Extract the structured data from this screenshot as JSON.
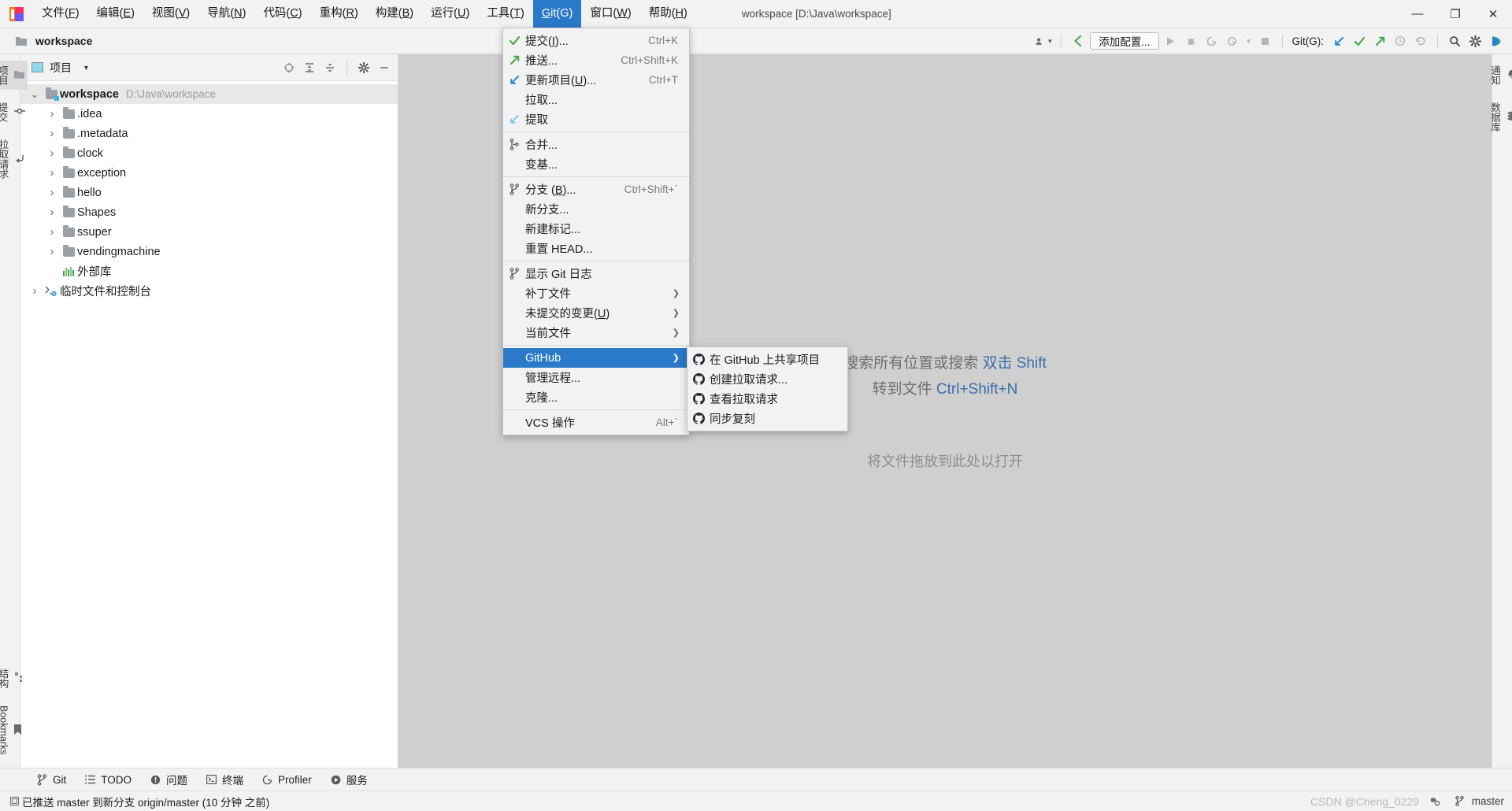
{
  "window": {
    "title": "workspace [D:\\Java\\workspace]",
    "controls": {
      "minimize": "—",
      "maximize": "❐",
      "close": "✕"
    }
  },
  "menubar": {
    "items": [
      {
        "label": "文件(F)",
        "mnemonic": "F",
        "active": false
      },
      {
        "label": "编辑(E)",
        "mnemonic": "E",
        "active": false
      },
      {
        "label": "视图(V)",
        "mnemonic": "V",
        "active": false
      },
      {
        "label": "导航(N)",
        "mnemonic": "N",
        "active": false
      },
      {
        "label": "代码(C)",
        "mnemonic": "C",
        "active": false
      },
      {
        "label": "重构(R)",
        "mnemonic": "R",
        "active": false
      },
      {
        "label": "构建(B)",
        "mnemonic": "B",
        "active": false
      },
      {
        "label": "运行(U)",
        "mnemonic": "U",
        "active": false
      },
      {
        "label": "工具(T)",
        "mnemonic": "T",
        "active": false
      },
      {
        "label": "Git(G)",
        "mnemonic": "G",
        "active": true
      },
      {
        "label": "窗口(W)",
        "mnemonic": "W",
        "active": false
      },
      {
        "label": "帮助(H)",
        "mnemonic": "H",
        "active": false
      }
    ]
  },
  "toolbar": {
    "project_name": "workspace",
    "add_config_label": "添加配置...",
    "git_label": "Git(G):",
    "icons": {
      "project_widget": "folder-icon",
      "vcs_user": "user-icon",
      "back": "back-arrow-icon",
      "run": "run-icon",
      "debug": "debug-icon",
      "run_coverage": "coverage-icon",
      "profile": "profile-icon",
      "stop": "stop-icon",
      "update": "update-project-icon",
      "commit": "commit-icon",
      "push": "push-icon",
      "history": "history-icon",
      "rollback": "rollback-icon",
      "search": "search-icon",
      "settings": "gear-icon",
      "ide_assistant": "ai-assistant-icon"
    }
  },
  "left_rail": {
    "top": [
      {
        "label": "项目",
        "icon": "project-icon",
        "selected": true
      },
      {
        "label": "提交",
        "icon": "commit-icon",
        "selected": false
      },
      {
        "label": "拉取请求",
        "icon": "pull-request-icon",
        "selected": false
      }
    ],
    "bottom": [
      {
        "label": "结构",
        "icon": "structure-icon",
        "selected": false
      },
      {
        "label": "Bookmarks",
        "icon": "bookmark-icon",
        "selected": false
      }
    ]
  },
  "right_rail": {
    "items": [
      {
        "label": "通知",
        "icon": "bell-icon",
        "badge": true
      },
      {
        "label": "数据库",
        "icon": "database-icon",
        "badge": false
      }
    ]
  },
  "project_panel": {
    "title": "项目",
    "tool_icons": [
      "locate-icon",
      "expand-all-icon",
      "collapse-all-icon",
      "gear-icon",
      "hide-icon"
    ],
    "tree": [
      {
        "label": "workspace",
        "path": "D:\\Java\\workspace",
        "arrow": "down",
        "icon": "module-folder",
        "depth": 0,
        "bold": true,
        "selected": true
      },
      {
        "label": ".idea",
        "path": "",
        "arrow": "right",
        "icon": "folder",
        "depth": 1,
        "bold": false,
        "selected": false
      },
      {
        "label": ".metadata",
        "path": "",
        "arrow": "right",
        "icon": "folder",
        "depth": 1,
        "bold": false,
        "selected": false
      },
      {
        "label": "clock",
        "path": "",
        "arrow": "right",
        "icon": "folder",
        "depth": 1,
        "bold": false,
        "selected": false
      },
      {
        "label": "exception",
        "path": "",
        "arrow": "right",
        "icon": "folder",
        "depth": 1,
        "bold": false,
        "selected": false
      },
      {
        "label": "hello",
        "path": "",
        "arrow": "right",
        "icon": "folder",
        "depth": 1,
        "bold": false,
        "selected": false
      },
      {
        "label": "Shapes",
        "path": "",
        "arrow": "right",
        "icon": "folder",
        "depth": 1,
        "bold": false,
        "selected": false
      },
      {
        "label": "ssuper",
        "path": "",
        "arrow": "right",
        "icon": "folder",
        "depth": 1,
        "bold": false,
        "selected": false
      },
      {
        "label": "vendingmachine",
        "path": "",
        "arrow": "right",
        "icon": "folder",
        "depth": 1,
        "bold": false,
        "selected": false
      },
      {
        "label": "外部库",
        "path": "",
        "arrow": "none",
        "icon": "library",
        "depth": 1,
        "bold": false,
        "selected": false
      },
      {
        "label": "临时文件和控制台",
        "path": "",
        "arrow": "right",
        "icon": "scratch",
        "depth": 0,
        "bold": false,
        "selected": false
      }
    ]
  },
  "editor": {
    "hints": [
      {
        "prefix": "搜索所有位置或搜索 ",
        "key": "双击 Shift"
      },
      {
        "prefix": "转到文件 ",
        "key": "Ctrl+Shift+N"
      }
    ],
    "drop_text": "将文件拖放到此处以打开"
  },
  "git_menu": {
    "items": [
      {
        "label": "提交(I)...",
        "mnemonic": "I",
        "shortcut": "Ctrl+K",
        "icon": "check-icon",
        "type": "item"
      },
      {
        "label": "推送...",
        "mnemonic": "",
        "shortcut": "Ctrl+Shift+K",
        "icon": "push-arrow-icon",
        "type": "item"
      },
      {
        "label": "更新项目(U)...",
        "mnemonic": "U",
        "shortcut": "Ctrl+T",
        "icon": "update-arrow-icon",
        "type": "item"
      },
      {
        "label": "拉取...",
        "mnemonic": "",
        "shortcut": "",
        "icon": "",
        "type": "item"
      },
      {
        "label": "提取",
        "mnemonic": "",
        "shortcut": "",
        "icon": "fetch-arrow-icon",
        "type": "item"
      },
      {
        "type": "separator"
      },
      {
        "label": "合并...",
        "mnemonic": "",
        "shortcut": "",
        "icon": "merge-icon",
        "type": "item"
      },
      {
        "label": "变基...",
        "mnemonic": "",
        "shortcut": "",
        "icon": "",
        "type": "item"
      },
      {
        "type": "separator"
      },
      {
        "label": "分支 (B)...",
        "mnemonic": "B",
        "shortcut": "Ctrl+Shift+`",
        "icon": "branch-icon",
        "type": "item"
      },
      {
        "label": "新分支...",
        "mnemonic": "",
        "shortcut": "",
        "icon": "",
        "type": "item"
      },
      {
        "label": "新建标记...",
        "mnemonic": "",
        "shortcut": "",
        "icon": "",
        "type": "item"
      },
      {
        "label": "重置 HEAD...",
        "mnemonic": "",
        "shortcut": "",
        "icon": "",
        "type": "item"
      },
      {
        "type": "separator"
      },
      {
        "label": "显示 Git 日志",
        "mnemonic": "",
        "shortcut": "",
        "icon": "branch-icon",
        "type": "item"
      },
      {
        "label": "补丁文件",
        "mnemonic": "",
        "shortcut": "",
        "icon": "",
        "type": "submenu"
      },
      {
        "label": "未提交的变更(U)",
        "mnemonic": "U",
        "shortcut": "",
        "icon": "",
        "type": "submenu"
      },
      {
        "label": "当前文件",
        "mnemonic": "",
        "shortcut": "",
        "icon": "",
        "type": "submenu"
      },
      {
        "type": "separator"
      },
      {
        "label": "GitHub",
        "mnemonic": "",
        "shortcut": "",
        "icon": "",
        "type": "submenu",
        "selected": true
      },
      {
        "label": "管理远程...",
        "mnemonic": "",
        "shortcut": "",
        "icon": "",
        "type": "item"
      },
      {
        "label": "克隆...",
        "mnemonic": "",
        "shortcut": "",
        "icon": "",
        "type": "item"
      },
      {
        "type": "separator"
      },
      {
        "label": "VCS 操作",
        "mnemonic": "",
        "shortcut": "Alt+`",
        "icon": "",
        "type": "item"
      }
    ]
  },
  "github_menu": {
    "items": [
      {
        "label": "在 GitHub 上共享项目",
        "icon": "github-icon"
      },
      {
        "label": "创建拉取请求...",
        "icon": "github-icon"
      },
      {
        "label": "查看拉取请求",
        "icon": "github-icon"
      },
      {
        "label": "同步复刻",
        "icon": "github-icon"
      }
    ]
  },
  "tool_window_bar": {
    "items": [
      {
        "label": "Git",
        "icon": "branch-icon"
      },
      {
        "label": "TODO",
        "icon": "list-icon"
      },
      {
        "label": "问题",
        "icon": "warning-icon"
      },
      {
        "label": "终端",
        "icon": "terminal-icon"
      },
      {
        "label": "Profiler",
        "icon": "profiler-icon"
      },
      {
        "label": "服务",
        "icon": "services-icon"
      }
    ]
  },
  "statusbar": {
    "message": "已推送 master 到新分支 origin/master (10 分钟 之前)",
    "icon": "event-log-icon",
    "branch": "master",
    "branch_icon": "branch-icon",
    "watermark": "CSDN @Cheng_0229"
  },
  "colors": {
    "accent": "#2b79c9",
    "menubar_bg": "#f2f2f2",
    "editor_bg": "#cfcfcf",
    "hint_link": "#3b6ea8",
    "badge": "#e8503a"
  }
}
